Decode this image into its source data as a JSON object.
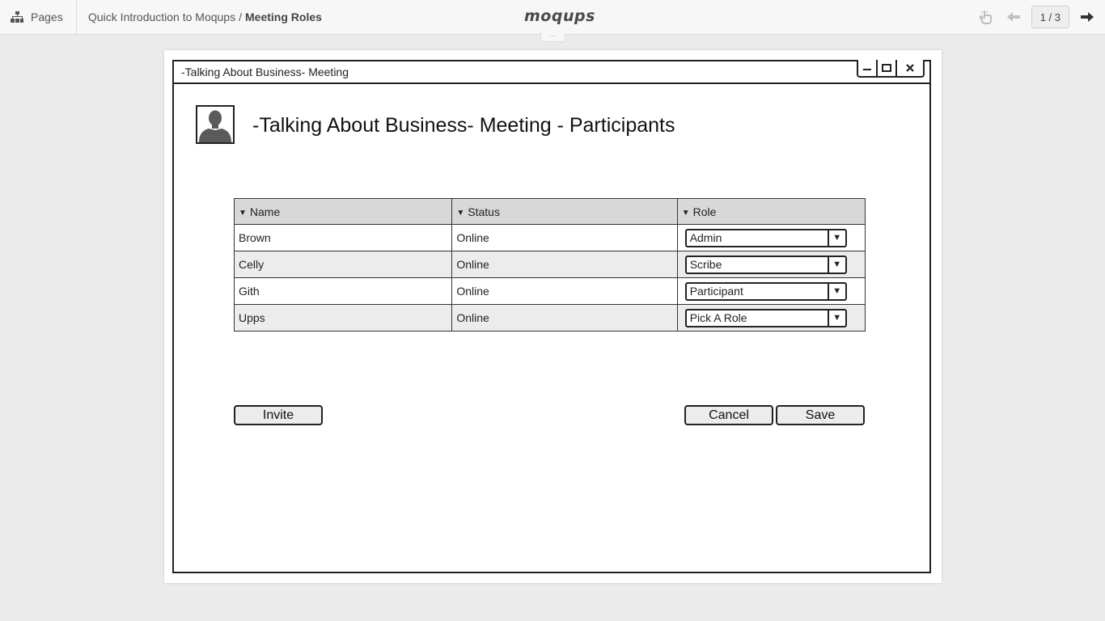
{
  "topbar": {
    "pages_label": "Pages",
    "breadcrumb_project": "Quick Introduction to Moqups",
    "breadcrumb_separator": "/",
    "breadcrumb_page": "Meeting Roles",
    "logo": "moqups",
    "page_counter": "1 / 3",
    "expand_label": "···"
  },
  "window": {
    "title": "-Talking About Business- Meeting",
    "heading": "-Talking About Business- Meeting - Participants"
  },
  "table": {
    "columns": [
      "Name",
      "Status",
      "Role"
    ],
    "sort_glyph": "▼",
    "rows": [
      {
        "name": "Brown",
        "status": "Online",
        "role": "Admin"
      },
      {
        "name": "Celly",
        "status": "Online",
        "role": "Scribe"
      },
      {
        "name": "Gith",
        "status": "Online",
        "role": "Participant"
      },
      {
        "name": "Upps",
        "status": "Online",
        "role": "Pick A Role"
      }
    ]
  },
  "buttons": {
    "invite": "Invite",
    "cancel": "Cancel",
    "save": "Save"
  },
  "icons": {
    "pages": "sitemap-icon",
    "hand": "hand-pointer-icon",
    "prev": "arrow-left-icon",
    "next": "arrow-right-icon",
    "minimize": "minimize-icon",
    "maximize": "maximize-icon",
    "close": "close-icon",
    "avatar": "user-avatar-icon"
  },
  "colors": {
    "background": "#ebebeb",
    "header_row": "#d8d8d8",
    "alt_row": "#ececec",
    "stroke": "#222222"
  }
}
